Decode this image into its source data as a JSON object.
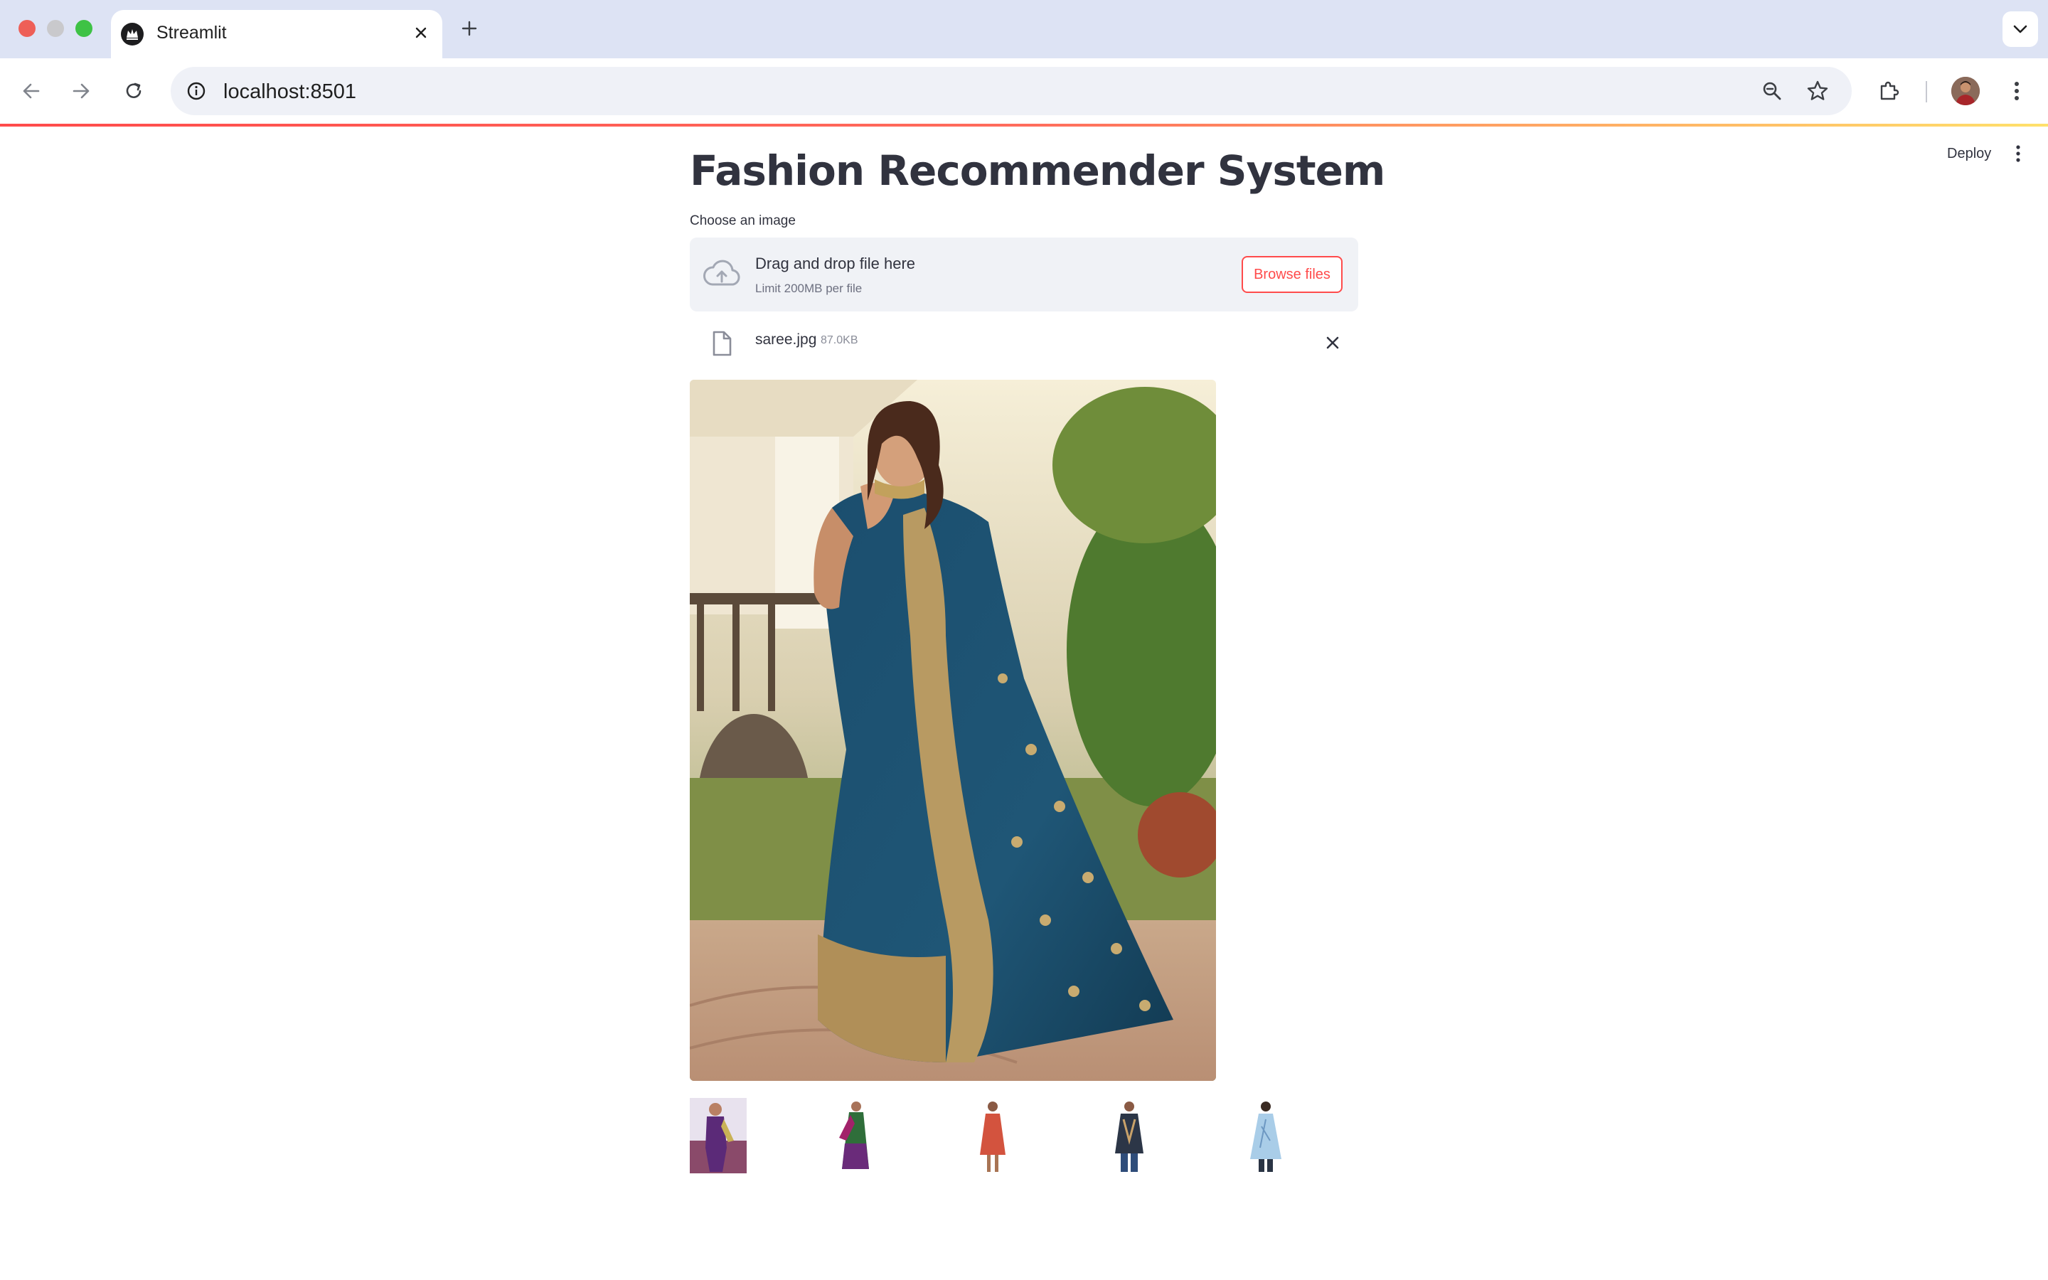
{
  "browser": {
    "tab_title": "Streamlit",
    "url": "localhost:8501"
  },
  "app": {
    "deploy_label": "Deploy",
    "title": "Fashion Recommender System",
    "uploader": {
      "label": "Choose an image",
      "drop_text": "Drag and drop file here",
      "limit_text": "Limit 200MB per file",
      "browse_label": "Browse files"
    },
    "uploaded_file": {
      "name": "saree.jpg",
      "size": "87.0KB"
    },
    "recommendations_count": 5
  },
  "colors": {
    "accent": "#ff4b4b",
    "tabstrip": "#dde3f4",
    "dropzone": "#f0f2f6",
    "text": "#31333f",
    "saree": "#1f4f6b",
    "gold_border": "#b89a62"
  }
}
